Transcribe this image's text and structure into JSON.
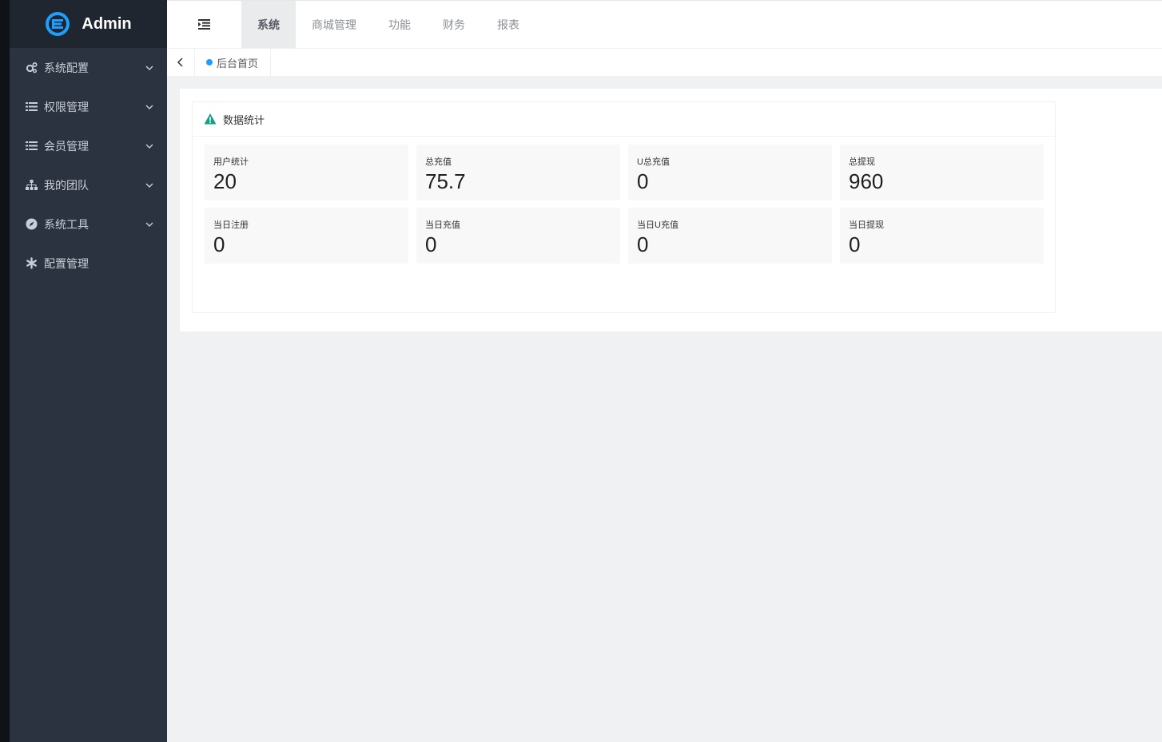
{
  "app": {
    "title": "Admin",
    "logo_icon": "globe-e-logo",
    "accent": "#1e9fff"
  },
  "sidebar": {
    "items": [
      {
        "label": "系统配置",
        "icon": "gears-icon",
        "has_arrow": true
      },
      {
        "label": "权限管理",
        "icon": "list-icon",
        "has_arrow": true
      },
      {
        "label": "会员管理",
        "icon": "list-icon",
        "has_arrow": true
      },
      {
        "label": "我的团队",
        "icon": "sitemap-icon",
        "has_arrow": true
      },
      {
        "label": "系统工具",
        "icon": "compass-icon",
        "has_arrow": true
      },
      {
        "label": "配置管理",
        "icon": "asterisk-icon",
        "has_arrow": false
      }
    ]
  },
  "topnav": {
    "collapse_icon": "indent-icon",
    "tabs": [
      {
        "label": "系统",
        "active": true
      },
      {
        "label": "商城管理",
        "active": false
      },
      {
        "label": "功能",
        "active": false
      },
      {
        "label": "财务",
        "active": false
      },
      {
        "label": "报表",
        "active": false
      }
    ]
  },
  "tabbar": {
    "back_icon": "chevron-left-icon",
    "tabs": [
      {
        "label": "后台首页"
      }
    ]
  },
  "panel": {
    "title": "数据统计",
    "icon": "warning-triangle-icon",
    "icon_color": "#16a085",
    "stats": [
      {
        "label": "用户统计",
        "value": "20"
      },
      {
        "label": "总充值",
        "value": "75.7"
      },
      {
        "label": "U总充值",
        "value": "0"
      },
      {
        "label": "总提现",
        "value": "960"
      },
      {
        "label": "当日注册",
        "value": "0"
      },
      {
        "label": "当日充值",
        "value": "0"
      },
      {
        "label": "当日U充值",
        "value": "0"
      },
      {
        "label": "当日提现",
        "value": "0"
      }
    ]
  }
}
